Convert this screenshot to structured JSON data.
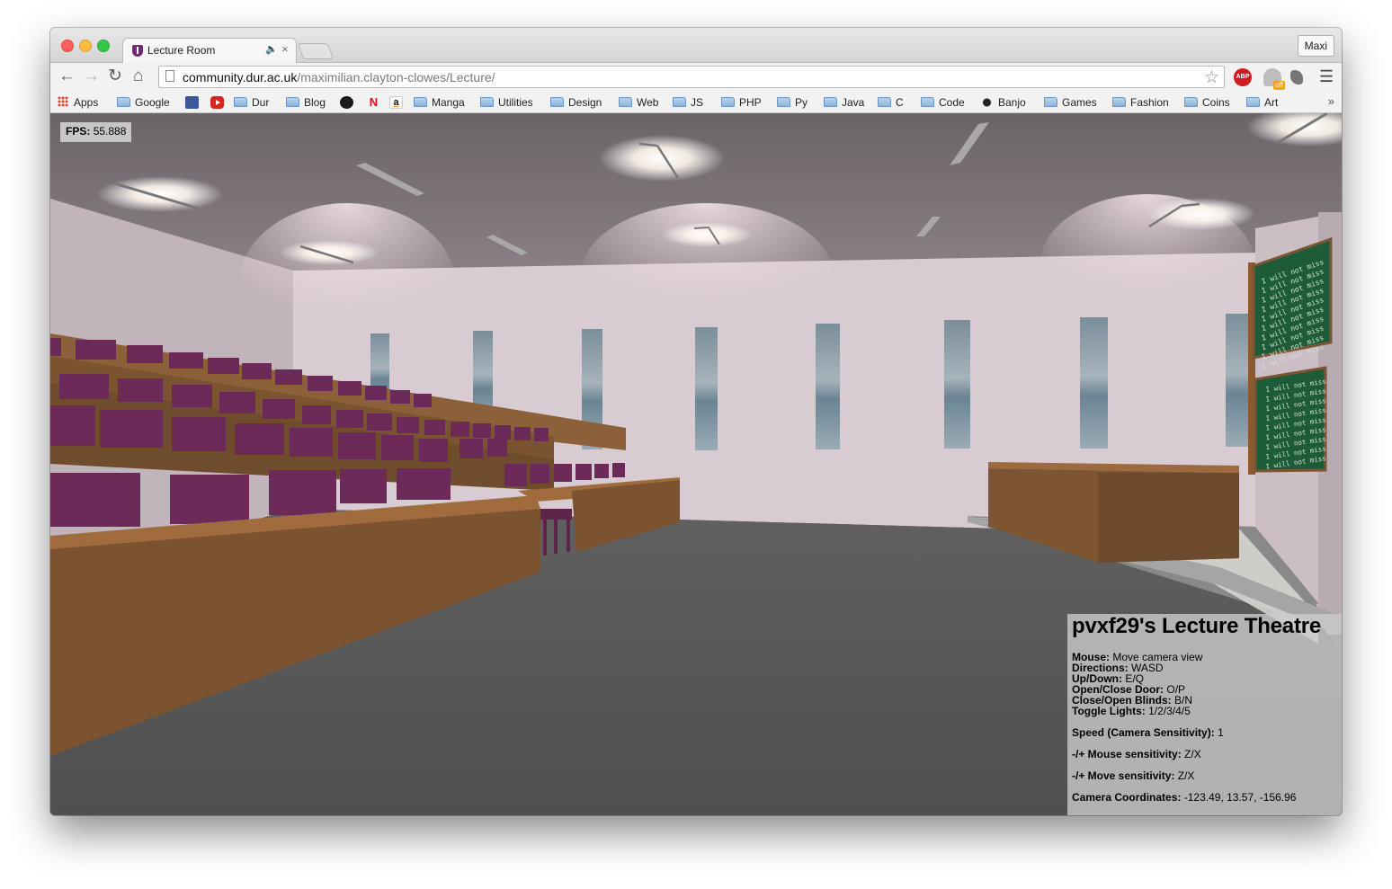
{
  "browser": {
    "tab": {
      "title": "Lecture Room",
      "close_glyph": "×",
      "audio_icon": "speaker-icon"
    },
    "profile_label": "Maxi",
    "url_host": "community.dur.ac.uk",
    "url_path": "/maximilian.clayton-clowes/Lecture/",
    "extensions": {
      "abp_label": "ABP",
      "ghostery_badge": "off"
    },
    "bookmarks": [
      {
        "label": "Apps",
        "icon": "apps-icon"
      },
      {
        "label": "Google",
        "icon": "folder-icon"
      },
      {
        "label": "",
        "icon": "facebook-icon"
      },
      {
        "label": "",
        "icon": "youtube-icon"
      },
      {
        "label": "Dur",
        "icon": "folder-icon"
      },
      {
        "label": "Blog",
        "icon": "folder-icon"
      },
      {
        "label": "",
        "icon": "github-icon"
      },
      {
        "label": "N",
        "icon": "netflix-icon"
      },
      {
        "label": "a",
        "icon": "amazon-icon"
      },
      {
        "label": "Manga",
        "icon": "folder-icon"
      },
      {
        "label": "Utilities",
        "icon": "folder-icon"
      },
      {
        "label": "Design",
        "icon": "folder-icon"
      },
      {
        "label": "Web",
        "icon": "folder-icon"
      },
      {
        "label": "JS",
        "icon": "folder-icon"
      },
      {
        "label": "PHP",
        "icon": "folder-icon"
      },
      {
        "label": "Py",
        "icon": "folder-icon"
      },
      {
        "label": "Java",
        "icon": "folder-icon"
      },
      {
        "label": "C",
        "icon": "folder-icon"
      },
      {
        "label": "Code",
        "icon": "folder-icon"
      },
      {
        "label": "Banjo",
        "icon": "banjo-icon"
      },
      {
        "label": "Games",
        "icon": "folder-icon"
      },
      {
        "label": "Fashion",
        "icon": "folder-icon"
      },
      {
        "label": "Coins",
        "icon": "folder-icon"
      },
      {
        "label": "Art",
        "icon": "folder-icon"
      }
    ],
    "more_glyph": "»"
  },
  "hud": {
    "fps_label": "FPS:",
    "fps_value": "55.888"
  },
  "info": {
    "title": "pvxf29's Lecture Theatre",
    "controls": [
      {
        "key": "Mouse:",
        "value": "Move camera view"
      },
      {
        "key": "Directions:",
        "value": "WASD"
      },
      {
        "key": "Up/Down:",
        "value": "E/Q"
      },
      {
        "key": "Open/Close Door:",
        "value": "O/P"
      },
      {
        "key": "Close/Open Blinds:",
        "value": "B/N"
      },
      {
        "key": "Toggle Lights:",
        "value": "1/2/3/4/5"
      }
    ],
    "speed_key": "Speed (Camera Sensitivity):",
    "speed_value": "1",
    "mouse_sens_key": "-/+ Mouse sensitivity:",
    "mouse_sens_value": "Z/X",
    "move_sens_key": "-/+ Move sensitivity:",
    "move_sens_value": "Z/X",
    "coords_key": "Camera Coordinates:",
    "coords_value": "-123.49, 13.57, -156.96"
  },
  "scene": {
    "blackboard_text": "I will not miss",
    "colors": {
      "ceiling": "#716a6f",
      "back_wall": "#d7c9cf",
      "side_wall": "#c9bcc2",
      "floor": "#575755",
      "desk": "#8a5b34",
      "seat": "#6e2a58",
      "blackboard": "#1f5c3a",
      "window": "#6b8593"
    }
  }
}
